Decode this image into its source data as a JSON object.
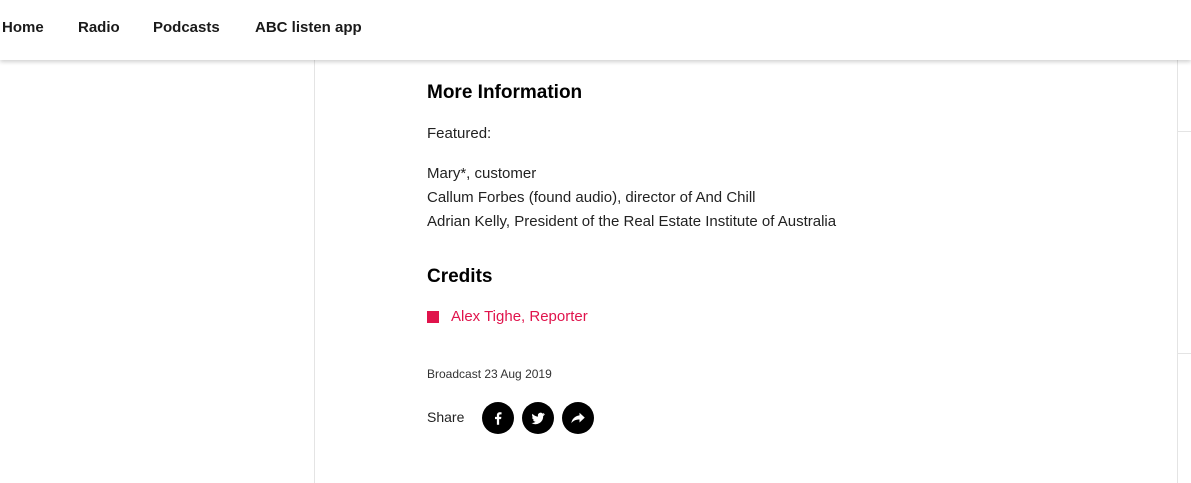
{
  "nav": {
    "items": [
      {
        "label": "Home"
      },
      {
        "label": "Radio"
      },
      {
        "label": "Podcasts"
      },
      {
        "label": "ABC listen app"
      }
    ]
  },
  "more_info": {
    "heading": "More Information",
    "featured_label": "Featured:",
    "people": [
      "Mary*, customer",
      "Callum Forbes (found audio), director of And Chill",
      "Adrian Kelly, President of the Real Estate Institute of Australia"
    ]
  },
  "credits": {
    "heading": "Credits",
    "items": [
      {
        "label": "Alex Tighe, Reporter"
      }
    ],
    "accent_color": "#e0144c"
  },
  "broadcast": {
    "text": "Broadcast 23 Aug 2019"
  },
  "share": {
    "label": "Share",
    "buttons": [
      {
        "icon": "facebook-icon"
      },
      {
        "icon": "twitter-icon"
      },
      {
        "icon": "share-icon"
      }
    ]
  }
}
